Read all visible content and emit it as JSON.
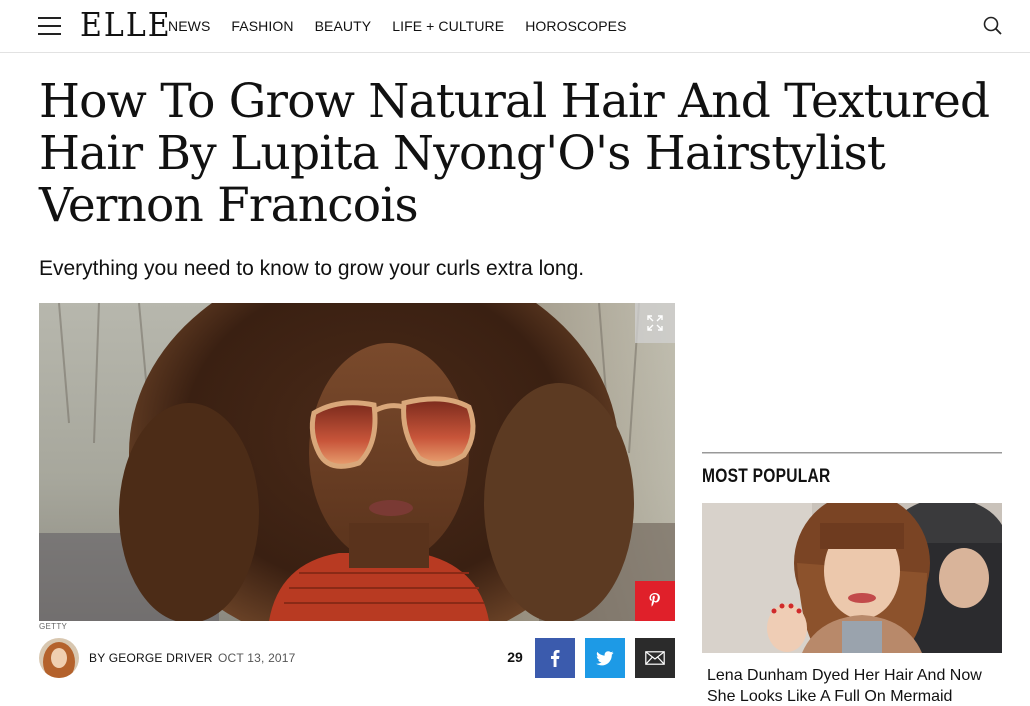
{
  "header": {
    "logo": "ELLE",
    "nav": [
      "NEWS",
      "FASHION",
      "BEAUTY",
      "LIFE + CULTURE",
      "HOROSCOPES"
    ]
  },
  "article": {
    "headline": "How To Grow Natural Hair And Textured Hair By Lupita Nyong'O's Hairstylist Vernon Francois",
    "dek": "Everything you need to know to grow your curls extra long.",
    "photo_credit": "GETTY",
    "byline": "BY GEORGE DRIVER",
    "date": "OCT 13, 2017",
    "share_count": "29"
  },
  "sidebar": {
    "most_popular_label": "MOST POPULAR",
    "items": [
      {
        "headline": "Lena Dunham Dyed Her Hair And Now She Looks Like A Full On Mermaid"
      }
    ]
  },
  "colors": {
    "pinterest": "#e0202a",
    "facebook": "#3b5bad",
    "twitter": "#1d9ae6",
    "email": "#2b2b2b"
  },
  "icons": [
    "menu-icon",
    "search-icon",
    "expand-icon",
    "pinterest-icon",
    "facebook-icon",
    "twitter-icon",
    "email-icon"
  ]
}
